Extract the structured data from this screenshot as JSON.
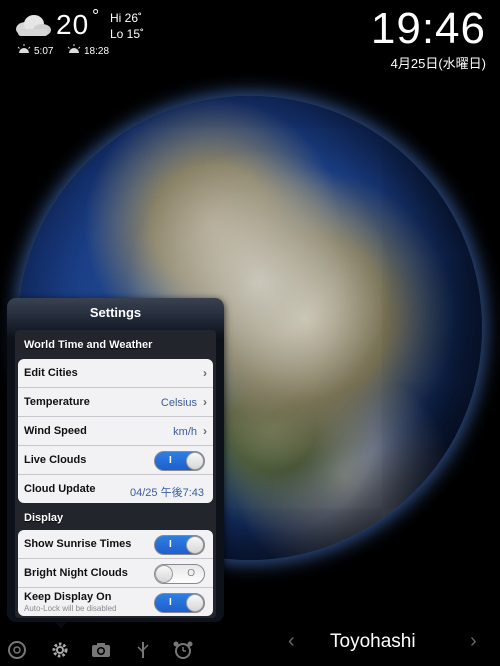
{
  "weather": {
    "temp": "20",
    "deg": "°",
    "hi": "Hi 26˚",
    "lo": "Lo 15˚",
    "sunrise": "5:07",
    "sunset": "18:28",
    "icon": "cloud-icon"
  },
  "clock": {
    "time": "19:46",
    "date": "4月25日(水曜日)"
  },
  "settings": {
    "title": "Settings",
    "section1": "World Time and Weather",
    "edit_cities": "Edit Cities",
    "temperature": "Temperature",
    "temperature_value": "Celsius",
    "wind_speed": "Wind Speed",
    "wind_speed_value": "km/h",
    "live_clouds": "Live Clouds",
    "live_clouds_on": true,
    "cloud_update": "Cloud Update",
    "cloud_update_value": "04/25 午後7:43",
    "section2": "Display",
    "show_sunrise": "Show Sunrise Times",
    "show_sunrise_on": true,
    "bright_night": "Bright Night Clouds",
    "bright_night_on": false,
    "keep_display": "Keep Display On",
    "keep_display_sub": "Auto-Lock will be disabled",
    "keep_display_on": true,
    "toggle_on_mark": "I",
    "toggle_off_mark": "O",
    "chevron": "›"
  },
  "toolbar": {
    "city": "Toyohashi",
    "prev": "‹",
    "next": "›",
    "icons": [
      "aperture-icon",
      "gear-icon",
      "camera-icon",
      "usb-icon",
      "alarm-clock-icon"
    ]
  }
}
